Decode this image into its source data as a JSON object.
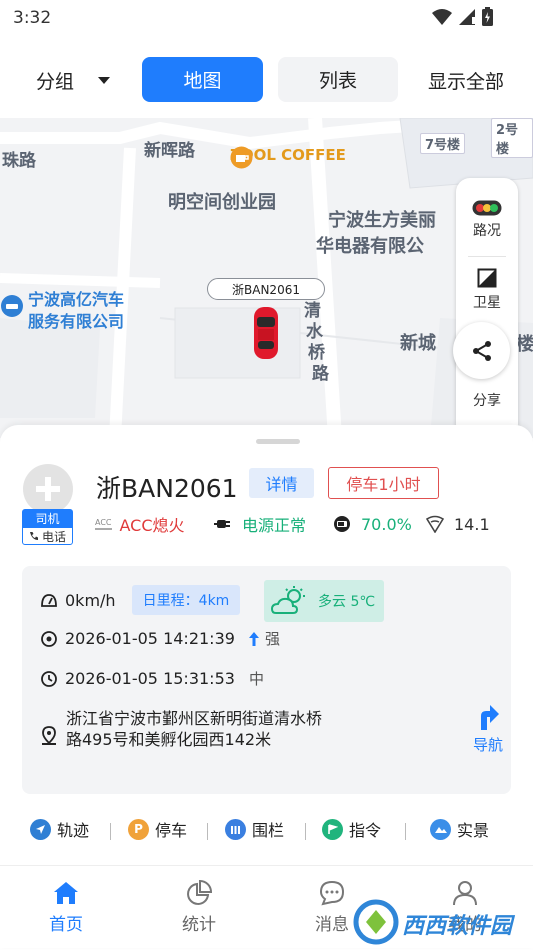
{
  "status_bar": {
    "time": "3:32"
  },
  "top_bar": {
    "group_label": "分组",
    "tab_map": "地图",
    "tab_list": "列表",
    "show_all": "显示全部"
  },
  "map": {
    "labels": {
      "road_zhu": "珠路",
      "road_xinhui": "新晖路",
      "coffee": "ZOOL COFFEE",
      "park": "明空间创业园",
      "company1": "宁波生方美丽",
      "company2": "华电器有限公",
      "gaoyi1": "宁波高亿汽车",
      "gaoyi2": "服务有限公司",
      "road_qing": "清",
      "road_shui": "水",
      "road_qiao": "桥",
      "road_lu": "路",
      "xincheng": "新城",
      "building7": "7号楼",
      "building2": "2号楼",
      "lou": "楼"
    },
    "car_tag": "浙BAN2061",
    "controls": {
      "traffic": "路况",
      "satellite": "卫星",
      "share": "分享"
    }
  },
  "vehicle": {
    "plate": "浙BAN2061",
    "driver_badge": "司机",
    "phone_badge": "电话",
    "detail_button": "详情",
    "park_status": "停车1小时",
    "acc_label": "ACC",
    "acc_status": "ACC熄火",
    "power_status": "电源正常",
    "battery": "70.0%",
    "signal": "14.1"
  },
  "info": {
    "speed": "0km/h",
    "mileage": "日里程：4km",
    "weather": "多云 5℃",
    "gps_time": "2026-01-05 14:21:39",
    "gps_strength": "强",
    "report_time": "2026-01-05 15:31:53",
    "report_strength": "中",
    "address": "浙江省宁波市鄞州区新明街道清水桥路495号和美孵化园西142米",
    "nav": "导航"
  },
  "actions": [
    "轨迹",
    "停车",
    "围栏",
    "指令",
    "实景"
  ],
  "bottom_nav": [
    "首页",
    "统计",
    "消息",
    "我的"
  ],
  "watermark": "西西软件园",
  "colors": {
    "primary": "#1f7dfd",
    "danger": "#e05050",
    "success": "#18b07a"
  }
}
